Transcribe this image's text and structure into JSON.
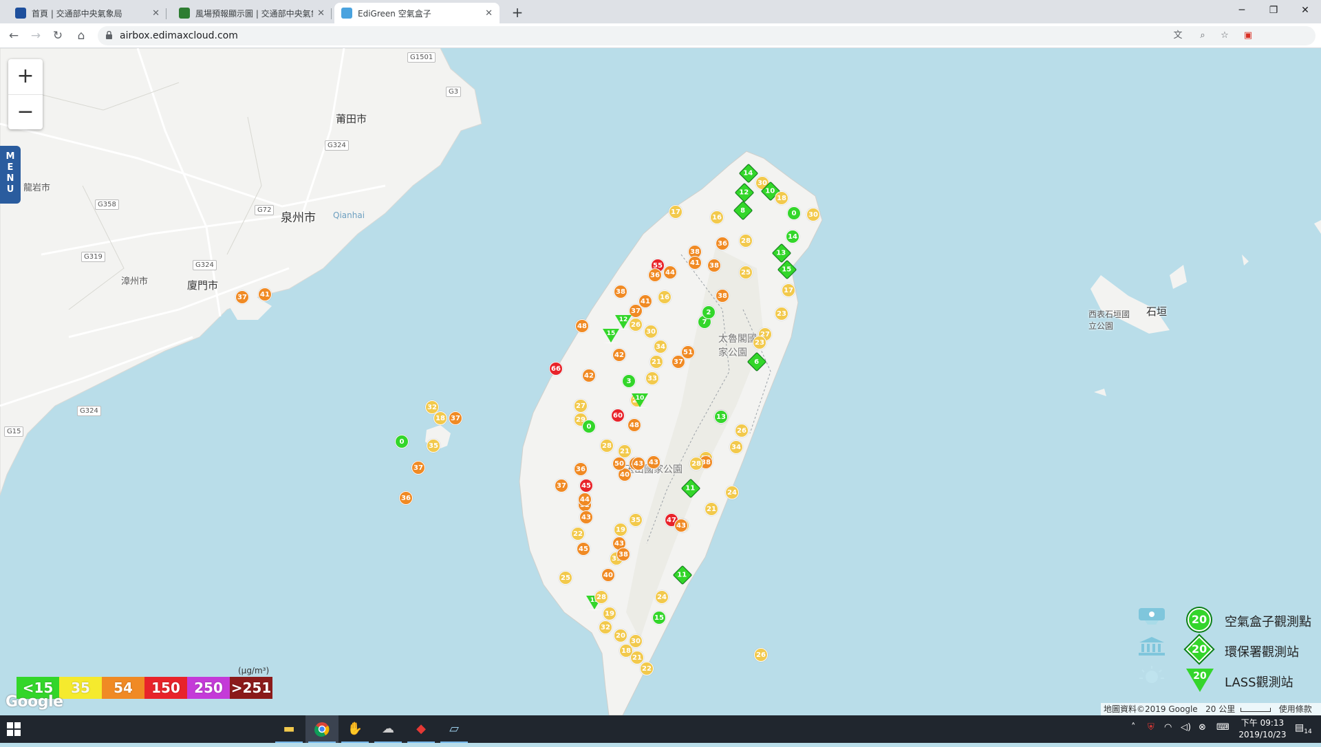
{
  "browser": {
    "tabs": [
      {
        "title": "首頁 | 交通部中央氣象局",
        "favicon_color": "#1e4f9c"
      },
      {
        "title": "風場預報顯示圖 | 交通部中央氣象",
        "favicon_color": "#2e7d32"
      },
      {
        "title": "EdiGreen 空氣盒子",
        "favicon_color": "#4aa3df"
      }
    ],
    "active_tab": 2,
    "url": "airbox.edimaxcloud.com"
  },
  "map": {
    "zoom_in_label": "+",
    "zoom_out_label": "−",
    "menu_label": "MENU",
    "places": [
      {
        "name": "莆田市"
      },
      {
        "name": "泉州市"
      },
      {
        "name": "龍岩市"
      },
      {
        "name": "漳州市"
      },
      {
        "name": "廈門市"
      },
      {
        "name": "Qianhai"
      },
      {
        "name": "太魯閣國家公園"
      },
      {
        "name": "玉山國家公園"
      },
      {
        "name": "西表石垣國立公園"
      },
      {
        "name": "石垣"
      }
    ],
    "roads": [
      "G1501",
      "G3",
      "G324",
      "G72",
      "G358",
      "G319",
      "G324",
      "G324",
      "G15"
    ],
    "markers": [
      {
        "v": 37,
        "c": "#f08a24",
        "t": "circle"
      },
      {
        "v": 41,
        "c": "#f08a24",
        "t": "circle"
      },
      {
        "v": 32,
        "c": "#f2c94c",
        "t": "circle"
      },
      {
        "v": 18,
        "c": "#f2c94c",
        "t": "circle"
      },
      {
        "v": 37,
        "c": "#f08a24",
        "t": "circle"
      },
      {
        "v": 0,
        "c": "#33d62a",
        "t": "circle"
      },
      {
        "v": 35,
        "c": "#f2c94c",
        "t": "circle"
      },
      {
        "v": 37,
        "c": "#f08a24",
        "t": "circle"
      },
      {
        "v": 36,
        "c": "#f08a24",
        "t": "circle"
      },
      {
        "v": 14,
        "c": "#33d62a",
        "t": "diamond"
      },
      {
        "v": 30,
        "c": "#f2c94c",
        "t": "circle"
      },
      {
        "v": 10,
        "c": "#33d62a",
        "t": "diamond"
      },
      {
        "v": 18,
        "c": "#f2c94c",
        "t": "circle"
      },
      {
        "v": 0,
        "c": "#33d62a",
        "t": "circle"
      },
      {
        "v": 30,
        "c": "#f2c94c",
        "t": "circle"
      },
      {
        "v": 12,
        "c": "#33d62a",
        "t": "diamond"
      },
      {
        "v": 8,
        "c": "#33d62a",
        "t": "diamond"
      },
      {
        "v": 17,
        "c": "#f2c94c",
        "t": "circle"
      },
      {
        "v": 16,
        "c": "#f2c94c",
        "t": "circle"
      },
      {
        "v": 36,
        "c": "#f08a24",
        "t": "circle"
      },
      {
        "v": 38,
        "c": "#f08a24",
        "t": "circle"
      },
      {
        "v": 41,
        "c": "#f08a24",
        "t": "circle"
      },
      {
        "v": 38,
        "c": "#f08a24",
        "t": "circle"
      },
      {
        "v": 28,
        "c": "#f2c94c",
        "t": "circle"
      },
      {
        "v": 14,
        "c": "#33d62a",
        "t": "circle"
      },
      {
        "v": 13,
        "c": "#33d62a",
        "t": "diamond"
      },
      {
        "v": 15,
        "c": "#33d62a",
        "t": "diamond"
      },
      {
        "v": 25,
        "c": "#f2c94c",
        "t": "circle"
      },
      {
        "v": 17,
        "c": "#f2c94c",
        "t": "circle"
      },
      {
        "v": 23,
        "c": "#f2c94c",
        "t": "circle"
      },
      {
        "v": 55,
        "c": "#e8232a",
        "t": "circle"
      },
      {
        "v": 44,
        "c": "#f08a24",
        "t": "circle"
      },
      {
        "v": 36,
        "c": "#f08a24",
        "t": "circle"
      },
      {
        "v": 38,
        "c": "#f08a24",
        "t": "circle"
      },
      {
        "v": 41,
        "c": "#f08a24",
        "t": "circle"
      },
      {
        "v": 16,
        "c": "#f2c94c",
        "t": "circle"
      },
      {
        "v": 37,
        "c": "#f08a24",
        "t": "circle"
      },
      {
        "v": 38,
        "c": "#f08a24",
        "t": "circle"
      },
      {
        "v": 7,
        "c": "#33d62a",
        "t": "circle"
      },
      {
        "v": 2,
        "c": "#33d62a",
        "t": "circle"
      },
      {
        "v": 48,
        "c": "#f08a24",
        "t": "circle"
      },
      {
        "v": 12,
        "c": "#33d62a",
        "t": "triangle"
      },
      {
        "v": 15,
        "c": "#33d62a",
        "t": "triangle"
      },
      {
        "v": 26,
        "c": "#f2c94c",
        "t": "circle"
      },
      {
        "v": 30,
        "c": "#f2c94c",
        "t": "circle"
      },
      {
        "v": 27,
        "c": "#f2c94c",
        "t": "circle"
      },
      {
        "v": 23,
        "c": "#f2c94c",
        "t": "circle"
      },
      {
        "v": 34,
        "c": "#f2c94c",
        "t": "circle"
      },
      {
        "v": 51,
        "c": "#f08a24",
        "t": "circle"
      },
      {
        "v": 37,
        "c": "#f08a24",
        "t": "circle"
      },
      {
        "v": 21,
        "c": "#f2c94c",
        "t": "circle"
      },
      {
        "v": 6,
        "c": "#33d62a",
        "t": "diamond"
      },
      {
        "v": 66,
        "c": "#e8232a",
        "t": "circle"
      },
      {
        "v": 42,
        "c": "#f08a24",
        "t": "circle"
      },
      {
        "v": 42,
        "c": "#f08a24",
        "t": "circle"
      },
      {
        "v": 3,
        "c": "#33d62a",
        "t": "circle"
      },
      {
        "v": 33,
        "c": "#f2c94c",
        "t": "circle"
      },
      {
        "v": 26,
        "c": "#f2c94c",
        "t": "circle"
      },
      {
        "v": 27,
        "c": "#f2c94c",
        "t": "circle"
      },
      {
        "v": 10,
        "c": "#33d62a",
        "t": "triangle"
      },
      {
        "v": 29,
        "c": "#f2c94c",
        "t": "circle"
      },
      {
        "v": 60,
        "c": "#e8232a",
        "t": "circle"
      },
      {
        "v": 44,
        "c": "#f08a24",
        "t": "circle"
      },
      {
        "v": 48,
        "c": "#f08a24",
        "t": "circle"
      },
      {
        "v": 13,
        "c": "#33d62a",
        "t": "circle"
      },
      {
        "v": 0,
        "c": "#33d62a",
        "t": "circle"
      },
      {
        "v": 26,
        "c": "#f2c94c",
        "t": "circle"
      },
      {
        "v": 34,
        "c": "#f2c94c",
        "t": "circle"
      },
      {
        "v": 24,
        "c": "#f2c94c",
        "t": "circle"
      },
      {
        "v": 28,
        "c": "#f2c94c",
        "t": "circle"
      },
      {
        "v": 21,
        "c": "#f2c94c",
        "t": "circle"
      },
      {
        "v": 43,
        "c": "#f08a24",
        "t": "circle"
      },
      {
        "v": 41,
        "c": "#f08a24",
        "t": "circle"
      },
      {
        "v": 40,
        "c": "#f08a24",
        "t": "circle"
      },
      {
        "v": 38,
        "c": "#f08a24",
        "t": "circle"
      },
      {
        "v": 36,
        "c": "#f08a24",
        "t": "circle"
      },
      {
        "v": 50,
        "c": "#f08a24",
        "t": "circle"
      },
      {
        "v": 43,
        "c": "#f08a24",
        "t": "circle"
      },
      {
        "v": 45,
        "c": "#e8232a",
        "t": "circle"
      },
      {
        "v": 37,
        "c": "#f08a24",
        "t": "circle"
      },
      {
        "v": 52,
        "c": "#f08a24",
        "t": "circle"
      },
      {
        "v": 44,
        "c": "#f08a24",
        "t": "circle"
      },
      {
        "v": 35,
        "c": "#f2c94c",
        "t": "circle"
      },
      {
        "v": 43,
        "c": "#f08a24",
        "t": "circle"
      },
      {
        "v": 47,
        "c": "#e8232a",
        "t": "circle"
      },
      {
        "v": 17,
        "c": "#f2c94c",
        "t": "circle"
      },
      {
        "v": 21,
        "c": "#f2c94c",
        "t": "circle"
      },
      {
        "v": 11,
        "c": "#33d62a",
        "t": "diamond"
      },
      {
        "v": 28,
        "c": "#f2c94c",
        "t": "circle"
      },
      {
        "v": 24,
        "c": "#f2c94c",
        "t": "circle"
      },
      {
        "v": 19,
        "c": "#f2c94c",
        "t": "circle"
      },
      {
        "v": 43,
        "c": "#f08a24",
        "t": "circle"
      },
      {
        "v": 39,
        "c": "#f2c94c",
        "t": "circle"
      },
      {
        "v": 38,
        "c": "#f08a24",
        "t": "circle"
      },
      {
        "v": 40,
        "c": "#f08a24",
        "t": "circle"
      },
      {
        "v": 43,
        "c": "#f08a24",
        "t": "circle"
      },
      {
        "v": 11,
        "c": "#33d62a",
        "t": "diamond"
      },
      {
        "v": 24,
        "c": "#f2c94c",
        "t": "circle"
      },
      {
        "v": 15,
        "c": "#33d62a",
        "t": "circle"
      },
      {
        "v": 19,
        "c": "#f2c94c",
        "t": "circle"
      },
      {
        "v": 22,
        "c": "#f2c94c",
        "t": "circle"
      },
      {
        "v": 45,
        "c": "#f08a24",
        "t": "circle"
      },
      {
        "v": 25,
        "c": "#f2c94c",
        "t": "circle"
      },
      {
        "v": 15,
        "c": "#33d62a",
        "t": "triangle"
      },
      {
        "v": 28,
        "c": "#f2c94c",
        "t": "circle"
      },
      {
        "v": 32,
        "c": "#f2c94c",
        "t": "circle"
      },
      {
        "v": 20,
        "c": "#f2c94c",
        "t": "circle"
      },
      {
        "v": 30,
        "c": "#f2c94c",
        "t": "circle"
      },
      {
        "v": 18,
        "c": "#f2c94c",
        "t": "circle"
      },
      {
        "v": 21,
        "c": "#f2c94c",
        "t": "circle"
      },
      {
        "v": 22,
        "c": "#f2c94c",
        "t": "circle"
      },
      {
        "v": 26,
        "c": "#f2c94c",
        "t": "circle"
      },
      {
        "v": 20,
        "c": "#f2c94c",
        "t": "circle"
      }
    ]
  },
  "legend": {
    "unit": "(μg/m³)",
    "scale": [
      {
        "label": "<15",
        "color": "#33d62a"
      },
      {
        "label": "35",
        "color": "#f5ea2d"
      },
      {
        "label": "54",
        "color": "#f08a24"
      },
      {
        "label": "150",
        "color": "#e8232a"
      },
      {
        "label": "250",
        "color": "#c43ad8"
      },
      {
        "label": ">251",
        "color": "#8b1a1a"
      }
    ],
    "stations": [
      {
        "marker_value": "20",
        "label": "空氣盒子觀測點"
      },
      {
        "marker_value": "20",
        "label": "環保署觀測站"
      },
      {
        "marker_value": "20",
        "label": "LASS觀測站"
      }
    ]
  },
  "attribution": {
    "google": "Google",
    "map_data": "地圖資料©2019 Google",
    "scale": "20 公里",
    "terms": "使用條款"
  },
  "taskbar": {
    "apps": [
      "file-explorer",
      "chrome",
      "app-3",
      "app-4",
      "app-5",
      "app-6"
    ],
    "time": "下午 09:13",
    "date": "2019/10/23",
    "notifications": "14"
  }
}
